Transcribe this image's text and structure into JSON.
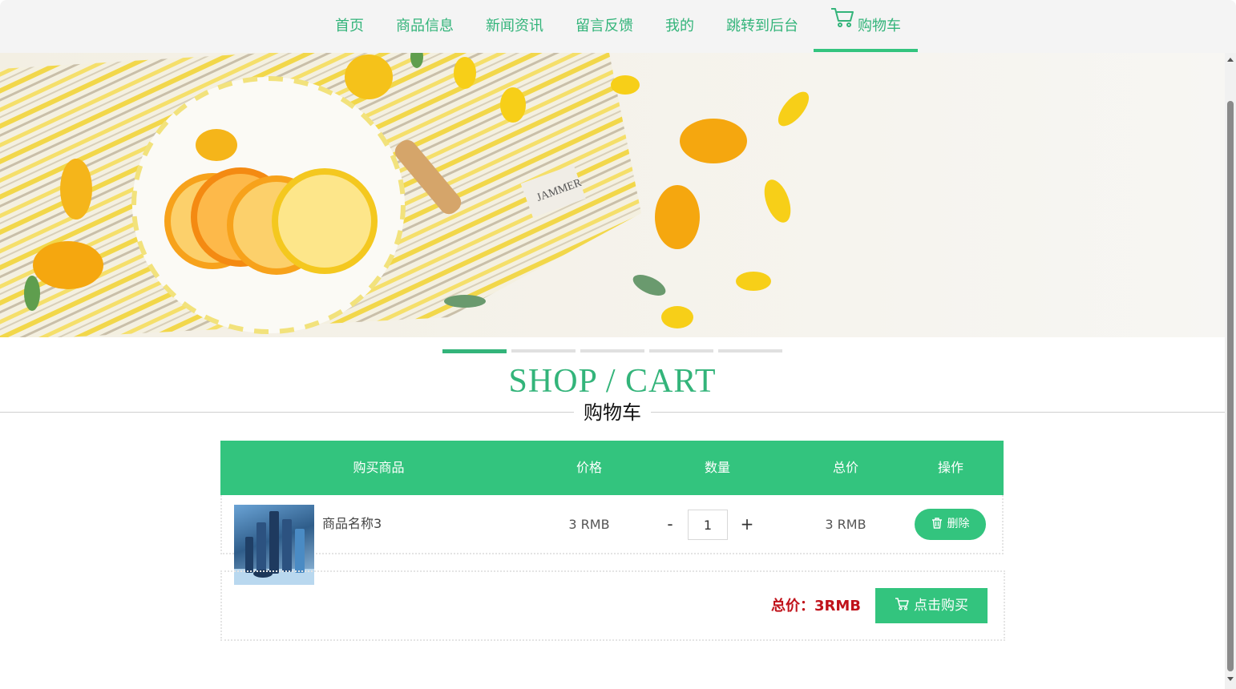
{
  "nav": {
    "items": [
      {
        "label": "首页"
      },
      {
        "label": "商品信息"
      },
      {
        "label": "新闻资讯"
      },
      {
        "label": "留言反馈"
      },
      {
        "label": "我的"
      },
      {
        "label": "跳转到后台"
      },
      {
        "label": "购物车",
        "icon": "cart-icon",
        "active": true
      }
    ]
  },
  "banner": {
    "slide_count": 5,
    "active_slide": 1,
    "image_text": "JAMMER"
  },
  "heading": {
    "title": "SHOP / CART",
    "subtitle": "购物车"
  },
  "table": {
    "headers": [
      "购买商品",
      "价格",
      "数量",
      "总价",
      "操作"
    ],
    "rows": [
      {
        "name": "商品名称3",
        "price": "3 RMB",
        "qty_minus": "-",
        "quantity": "1",
        "qty_plus": "+",
        "subtotal": "3 RMB",
        "delete_label": "删除",
        "delete_icon": "trash-icon"
      }
    ]
  },
  "summary": {
    "total": "总价：3RMB",
    "buy_label": "点击购买",
    "buy_icon": "cart-icon"
  },
  "colors": {
    "accent": "#33c47e",
    "nav_text": "#33b47a",
    "total_text": "#c0121a"
  }
}
